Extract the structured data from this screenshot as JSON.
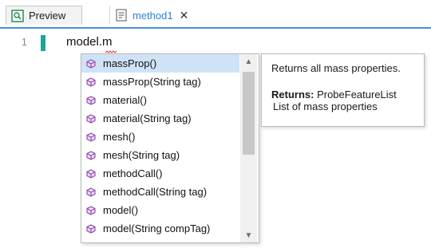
{
  "tabs": {
    "preview_label": "Preview",
    "method_label": "method1",
    "close_glyph": "✕"
  },
  "editor": {
    "line_number": "1",
    "code_text": "model.m"
  },
  "completion": {
    "items": [
      {
        "label": "massProp()"
      },
      {
        "label": "massProp(String tag)"
      },
      {
        "label": "material()"
      },
      {
        "label": "material(String tag)"
      },
      {
        "label": "mesh()"
      },
      {
        "label": "mesh(String tag)"
      },
      {
        "label": "methodCall()"
      },
      {
        "label": "methodCall(String tag)"
      },
      {
        "label": "model()"
      },
      {
        "label": "model(String compTag)"
      }
    ],
    "scroll_up_glyph": "▲",
    "scroll_down_glyph": "▼"
  },
  "tooltip": {
    "description": "Returns all mass properties.",
    "returns_label": "Returns:",
    "returns_type": " ProbeFeatureList",
    "returns_description": "List of mass properties"
  },
  "colors": {
    "accent_blue": "#2d7fd3",
    "selection": "#cfe3f7",
    "line_marker": "#1ea59a",
    "method_icon": "#8e44ad"
  },
  "icons": {
    "preview_tab": "magnifier-preview-icon",
    "method_tab": "method-document-icon",
    "completion_item": "method-cube-icon"
  }
}
